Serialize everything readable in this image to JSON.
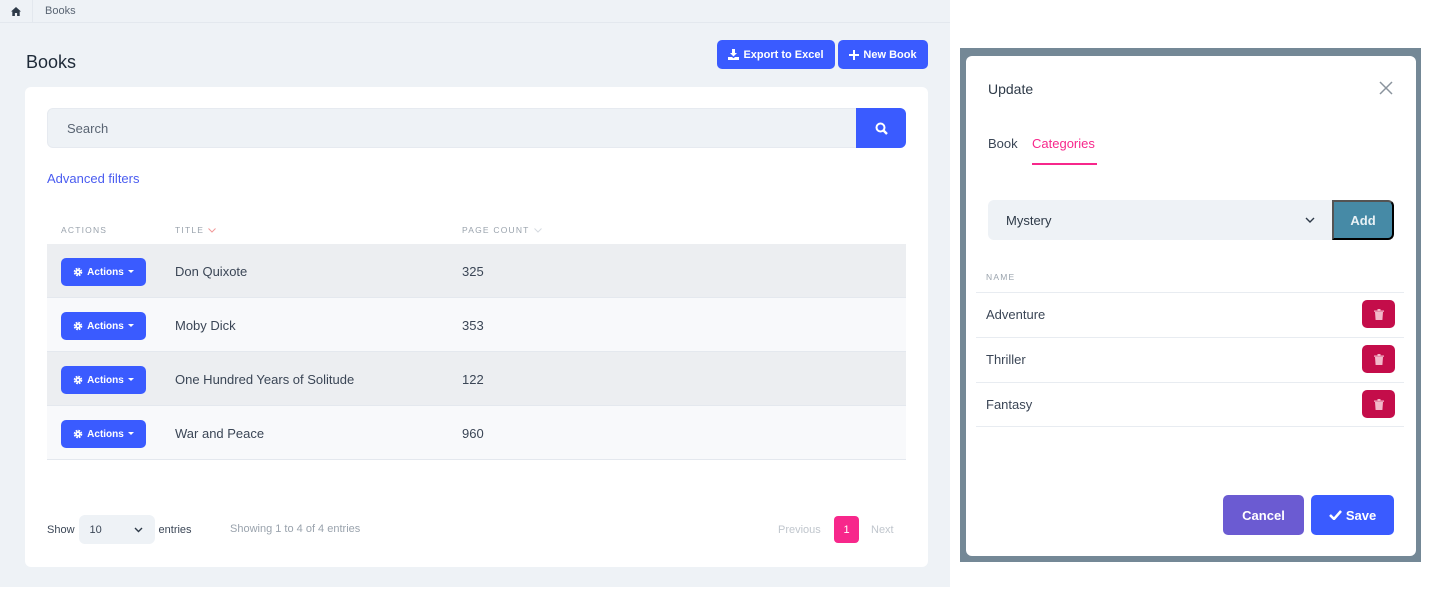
{
  "breadcrumb": {
    "home_icon": "home-icon",
    "current": "Books"
  },
  "page": {
    "title": "Books",
    "export_label": "Export to Excel",
    "new_label": "New Book"
  },
  "search": {
    "placeholder": "Search",
    "advanced_filters": "Advanced filters"
  },
  "table": {
    "columns": [
      "ACTIONS",
      "TITLE",
      "PAGE COUNT"
    ],
    "action_label": "Actions",
    "rows": [
      {
        "title": "Don Quixote",
        "pages": "325"
      },
      {
        "title": "Moby Dick",
        "pages": "353"
      },
      {
        "title": "One Hundred Years of Solitude",
        "pages": "122"
      },
      {
        "title": "War and Peace",
        "pages": "960"
      }
    ]
  },
  "footer": {
    "show": "Show",
    "page_size": "10",
    "entries": "entries",
    "info": "Showing 1 to 4 of 4 entries",
    "previous": "Previous",
    "current_page": "1",
    "next": "Next"
  },
  "modal": {
    "title": "Update",
    "tabs": [
      {
        "label": "Book",
        "active": false
      },
      {
        "label": "Categories",
        "active": true
      }
    ],
    "category_select": "Mystery",
    "add_label": "Add",
    "name_header": "NAME",
    "categories": [
      "Adventure",
      "Thriller",
      "Fantasy"
    ],
    "cancel_label": "Cancel",
    "save_label": "Save"
  },
  "colors": {
    "primary": "#3a5bff",
    "accent": "#f7278b",
    "danger": "#c40d4a",
    "add": "#468aa6",
    "cancel": "#6b5bd2"
  }
}
